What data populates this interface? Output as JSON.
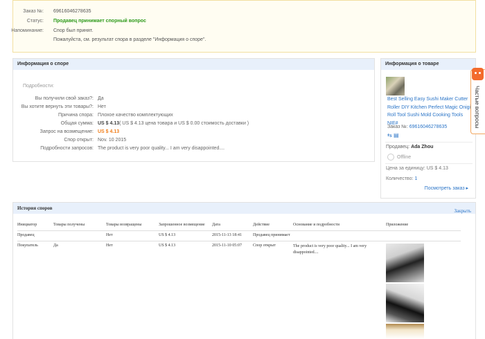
{
  "order": {
    "order_no_label": "Заказ №:",
    "order_no": "69616046278635",
    "status_label": "Статус:",
    "status": "Продавец принимает спорный вопрос",
    "reminder_label": "Напоминание:",
    "reminder_1": "Спор был принят.",
    "reminder_2": "Пожалуйста, см. результат спора в разделе \"Информация о споре\"."
  },
  "dispute": {
    "title": "Информация о споре",
    "subtitle": "Подробности:",
    "rows": [
      {
        "label": "Вы получили свой заказ?:",
        "value": "Да"
      },
      {
        "label": "Вы хотите вернуть эти товары?:",
        "value": "Нет"
      },
      {
        "label": "Причина спора:",
        "value": "Плохое качество комплектующих"
      },
      {
        "label": "Общая сумма:",
        "value": "US $ 4.13",
        "extra": "( US $ 4.13 цена товара и US $ 0.00 стоимость доставки )"
      },
      {
        "label": "Запрос на возмещение:",
        "value": "US $ 4.13"
      },
      {
        "label": "Спор открыт:",
        "value": "Nov. 10 2015"
      },
      {
        "label": "Подробности запросов:",
        "value": "The product is very poor quality... I am very disappointed...."
      }
    ]
  },
  "product": {
    "title": "Информация о товаре",
    "name": "Best Selling Easy Sushi Maker Cutter Roller DIY Kitchen Perfect Magic Onigiri Roll Tool Sushi Mold Cooking Tools NIE#",
    "order_label": "Заказ №:",
    "order_no": "69616046278635",
    "seller_label": "Продавец:",
    "seller": "Ada Zhou",
    "status": "Offline",
    "unit_price": "Цена за единицу: US $ 4.13",
    "qty_label": "Количество:",
    "qty": "1",
    "view_order": "Посмотреть заказ ▸"
  },
  "faq": {
    "label": "Частые вопросы"
  },
  "history": {
    "title": "История споров",
    "close": "Закрыть",
    "columns": [
      "Инициатор",
      "Товары получены",
      "Товары возвращены",
      "Запрошенное возмещение",
      "Дата",
      "Действие",
      "Основание и подробности",
      "Приложение"
    ],
    "rows": [
      [
        "Продавец",
        "",
        "Нет",
        "US $ 4.13",
        "2015-11-13 18:41",
        "Продавец принимает",
        "",
        ""
      ],
      [
        "Покупатель",
        "Да",
        "Нет",
        "US $ 4.13",
        "2015-11-10 05:07",
        "Спор открыт",
        "The product is very poor quality... I am very disappointed....",
        ""
      ]
    ]
  }
}
